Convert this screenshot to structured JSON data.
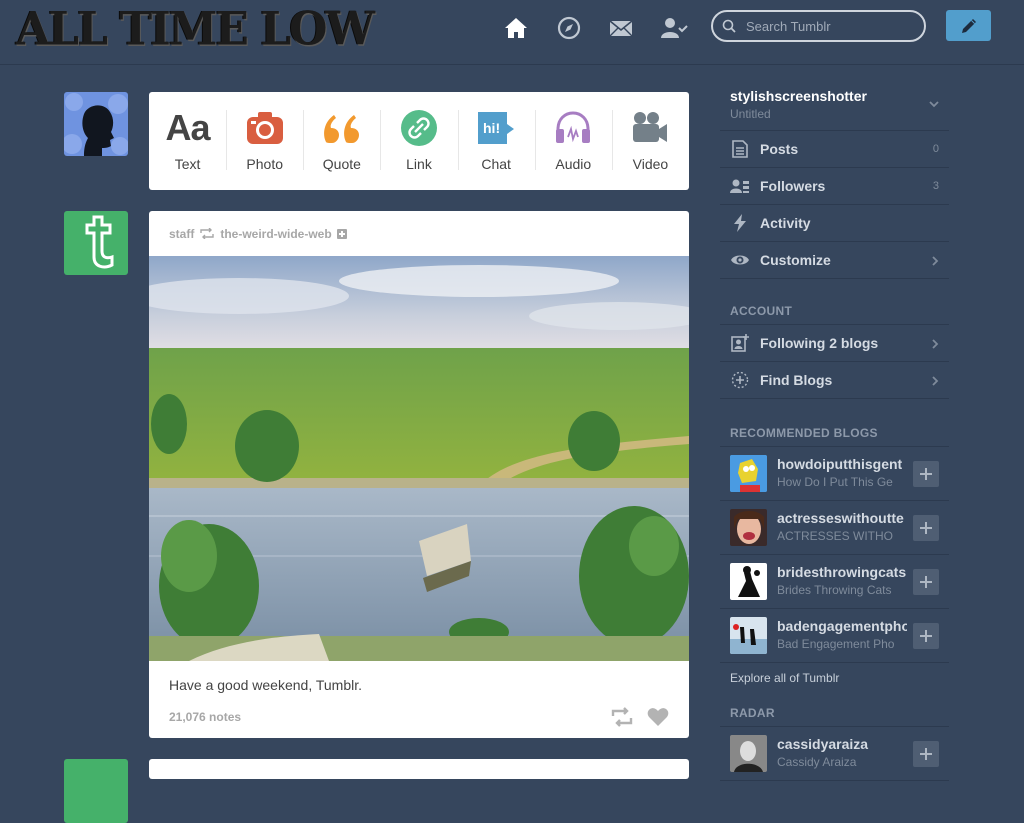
{
  "header": {
    "logo_text": "ALL TIME LOW",
    "search_placeholder": "Search Tumblr",
    "nav_icons": [
      "home-icon",
      "explore-compass-icon",
      "inbox-mail-icon",
      "account-icon"
    ],
    "compose_icon": "pencil-icon",
    "colors": {
      "background": "#36465d",
      "compose": "#529ecc"
    }
  },
  "post_types": [
    {
      "label": "Text",
      "icon": "text-aa-icon",
      "color": "#444444"
    },
    {
      "label": "Photo",
      "icon": "camera-icon",
      "color": "#d95e40"
    },
    {
      "label": "Quote",
      "icon": "quote-icon",
      "color": "#f2992e"
    },
    {
      "label": "Link",
      "icon": "link-icon",
      "color": "#56bc8a"
    },
    {
      "label": "Chat",
      "icon": "chat-hi-icon",
      "color": "#529ecc"
    },
    {
      "label": "Audio",
      "icon": "headphones-icon",
      "color": "#a77dc2"
    },
    {
      "label": "Video",
      "icon": "video-camera-icon",
      "color": "#748089"
    }
  ],
  "post": {
    "author": "staff",
    "reblogged_from": "the-weird-wide-web",
    "caption": "Have a good weekend, Tumblr.",
    "notes": "21,076 notes"
  },
  "sidebar": {
    "blog_name": "stylishscreenshotter",
    "blog_title": "Untitled",
    "menu": [
      {
        "label": "Posts",
        "count": "0",
        "icon": "posts-icon"
      },
      {
        "label": "Followers",
        "count": "3",
        "icon": "followers-icon"
      },
      {
        "label": "Activity",
        "count": "",
        "icon": "lightning-icon"
      },
      {
        "label": "Customize",
        "count": "",
        "icon": "eye-icon"
      }
    ],
    "account_title": "ACCOUNT",
    "account_items": [
      {
        "label": "Following 2 blogs",
        "icon": "following-icon"
      },
      {
        "label": "Find Blogs",
        "icon": "find-blogs-icon"
      }
    ],
    "recommended_title": "RECOMMENDED BLOGS",
    "recommended": [
      {
        "name": "howdoiputthisgent",
        "title": "How Do I Put This Ge"
      },
      {
        "name": "actresseswithoutte",
        "title": "ACTRESSES WITHO"
      },
      {
        "name": "bridesthrowingcats",
        "title": "Brides Throwing Cats"
      },
      {
        "name": "badengagementpho",
        "title": "Bad Engagement Pho"
      }
    ],
    "explore_link": "Explore all of Tumblr",
    "radar_title": "RADAR",
    "radar": [
      {
        "name": "cassidyaraiza",
        "title": "Cassidy Araiza"
      }
    ]
  }
}
